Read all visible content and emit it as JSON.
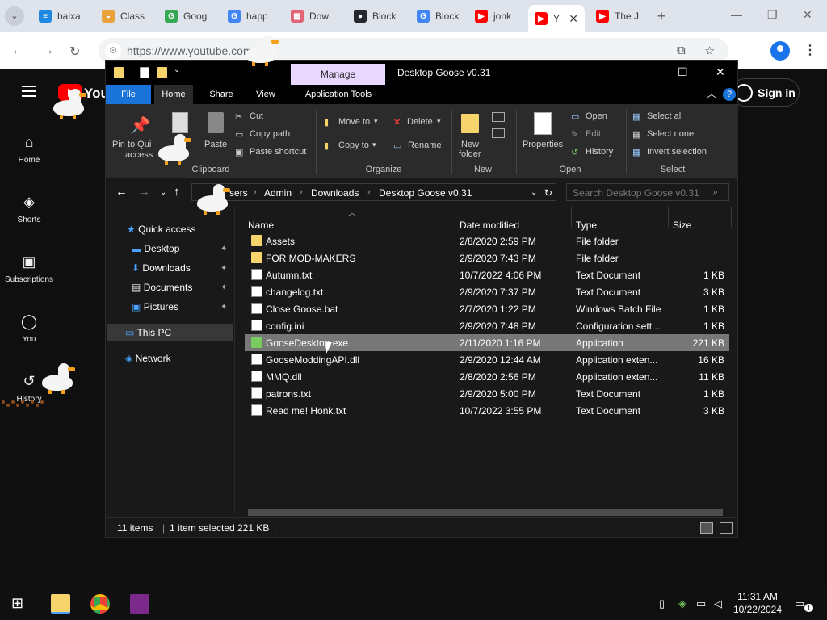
{
  "browser": {
    "tabs": [
      {
        "label": "baixa",
        "color": "#1e88e5",
        "glyph": "≡"
      },
      {
        "label": "Class",
        "color": "#e8a33d",
        "glyph": "◒"
      },
      {
        "label": "Goog",
        "color": "#34a853",
        "glyph": "G"
      },
      {
        "label": "happ",
        "color": "#4285f4",
        "glyph": "G"
      },
      {
        "label": "Dow",
        "color": "#e06377",
        "glyph": "▦"
      },
      {
        "label": "Block",
        "color": "#24292f",
        "glyph": "●"
      },
      {
        "label": "Block",
        "color": "#4285f4",
        "glyph": "G"
      },
      {
        "label": "jonk",
        "color": "#ff0000",
        "glyph": "▶"
      },
      {
        "label": "Y",
        "color": "#ff0000",
        "glyph": "▶"
      },
      {
        "label": "The J",
        "color": "#ff0000",
        "glyph": "▶"
      }
    ],
    "active_tab_close": "✕",
    "new_tab": "+",
    "url": "https://www.youtube.com"
  },
  "youtube": {
    "logo_text": "You",
    "nav": [
      {
        "label": "Home",
        "icon": "home-icon",
        "glyph": "⌂"
      },
      {
        "label": "Shorts",
        "icon": "shorts-icon",
        "glyph": "◈"
      },
      {
        "label": "Subscriptions",
        "icon": "subscriptions-icon",
        "glyph": "▣"
      },
      {
        "label": "You",
        "icon": "you-icon",
        "glyph": "◯"
      },
      {
        "label": "History",
        "icon": "history-icon",
        "glyph": "↺"
      }
    ],
    "signin_label": "Sign in"
  },
  "explorer": {
    "title": "Desktop Goose v0.31",
    "manage_tab": "Manage",
    "ribbon_tabs": [
      "File",
      "Home",
      "Share",
      "View",
      "Application Tools"
    ],
    "clipboard": {
      "pin_label_1": "Pin to Qui",
      "pin_label_2": "access",
      "copy": "Copy",
      "paste": "Paste",
      "cut": "Cut",
      "copy_path": "Copy path",
      "paste_shortcut": "Paste shortcut",
      "group": "Clipboard"
    },
    "organize": {
      "move_to": "Move to",
      "copy_to": "Copy to",
      "delete": "Delete",
      "rename": "Rename",
      "group": "Organize"
    },
    "new": {
      "new_folder_1": "New",
      "new_folder_2": "folder",
      "group": "New"
    },
    "open": {
      "properties": "Properties",
      "open": "Open",
      "edit": "Edit",
      "history": "History",
      "group": "Open"
    },
    "select": {
      "select_all": "Select all",
      "select_none": "Select none",
      "invert": "Invert selection",
      "group": "Select"
    },
    "breadcrumb": [
      "sers",
      "Admin",
      "Downloads",
      "Desktop Goose v0.31"
    ],
    "search_placeholder": "Search Desktop Goose v0.31",
    "nav_tree": {
      "quick_access": "Quick access",
      "desktop": "Desktop",
      "downloads": "Downloads",
      "documents": "Documents",
      "pictures": "Pictures",
      "this_pc": "This PC",
      "network": "Network"
    },
    "columns": [
      "Name",
      "Date modified",
      "Type",
      "Size"
    ],
    "files": [
      {
        "name": "Assets",
        "date": "2/8/2020 2:59 PM",
        "type": "File folder",
        "size": "",
        "kind": "folder"
      },
      {
        "name": "FOR MOD-MAKERS",
        "date": "2/9/2020 7:43 PM",
        "type": "File folder",
        "size": "",
        "kind": "folder"
      },
      {
        "name": "Autumn.txt",
        "date": "10/7/2022 4:06 PM",
        "type": "Text Document",
        "size": "1 KB",
        "kind": "doc"
      },
      {
        "name": "changelog.txt",
        "date": "2/9/2020 7:37 PM",
        "type": "Text Document",
        "size": "3 KB",
        "kind": "doc"
      },
      {
        "name": "Close Goose.bat",
        "date": "2/7/2020 1:22 PM",
        "type": "Windows Batch File",
        "size": "1 KB",
        "kind": "doc"
      },
      {
        "name": "config.ini",
        "date": "2/9/2020 7:48 PM",
        "type": "Configuration sett...",
        "size": "1 KB",
        "kind": "doc"
      },
      {
        "name": "GooseDesktop.exe",
        "date": "2/11/2020 1:16 PM",
        "type": "Application",
        "size": "221 KB",
        "kind": "app",
        "selected": true
      },
      {
        "name": "GooseModdingAPI.dll",
        "date": "2/9/2020 12:44 AM",
        "type": "Application exten...",
        "size": "16 KB",
        "kind": "doc"
      },
      {
        "name": "MMQ.dll",
        "date": "2/8/2020 2:56 PM",
        "type": "Application exten...",
        "size": "11 KB",
        "kind": "doc"
      },
      {
        "name": "patrons.txt",
        "date": "2/9/2020 5:00 PM",
        "type": "Text Document",
        "size": "1 KB",
        "kind": "doc"
      },
      {
        "name": "Read me! Honk.txt",
        "date": "10/7/2022 3:55 PM",
        "type": "Text Document",
        "size": "3 KB",
        "kind": "doc"
      }
    ],
    "status": {
      "items": "11 items",
      "selected": "1 item selected",
      "size": "221 KB"
    }
  },
  "taskbar": {
    "time": "11:31 AM",
    "date": "10/22/2024",
    "notification_badge": "1"
  }
}
